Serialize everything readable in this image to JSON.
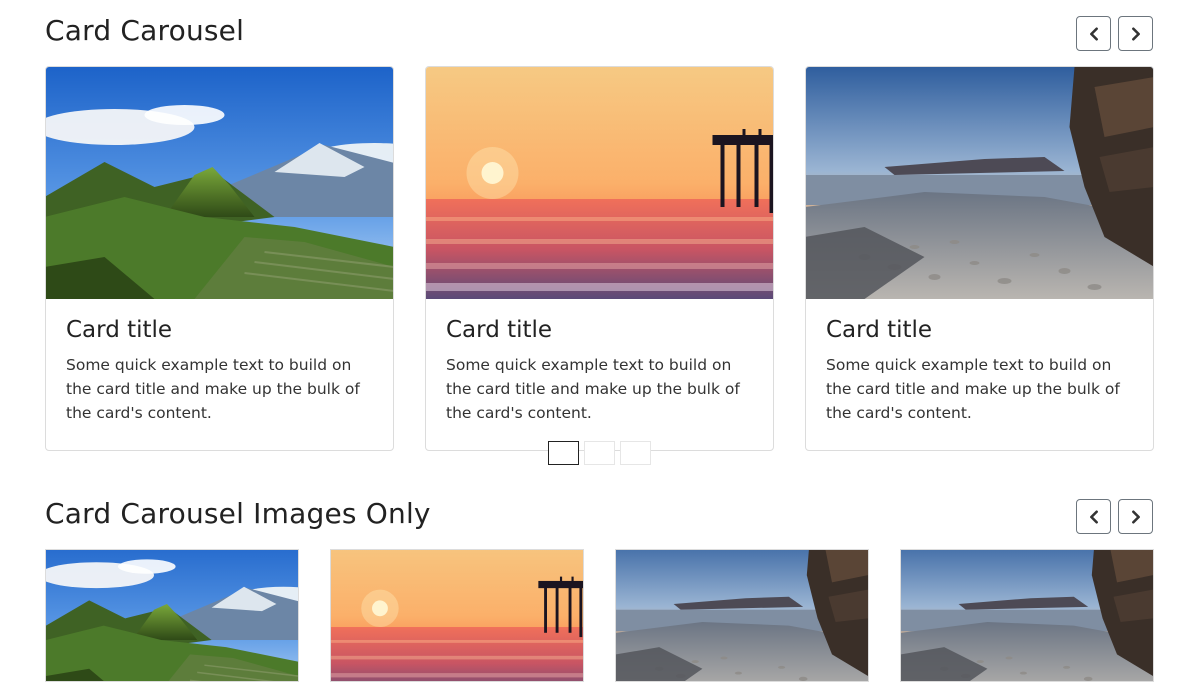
{
  "carousel1": {
    "title": "Card Carousel",
    "prev_icon": "chevron-left-icon",
    "next_icon": "chevron-right-icon",
    "cards": [
      {
        "image": "mountain-ruins-photo",
        "title": "Card title",
        "text": "Some quick example text to build on the card title and make up the bulk of the card's content."
      },
      {
        "image": "sunset-pier-photo",
        "title": "Card title",
        "text": "Some quick example text to build on the card title and make up the bulk of the card's content."
      },
      {
        "image": "rocky-beach-photo",
        "title": "Card title",
        "text": "Some quick example text to build on the card title and make up the bulk of the card's content."
      }
    ],
    "indicators": 3,
    "active_indicator": 0
  },
  "carousel2": {
    "title": "Card Carousel Images Only",
    "prev_icon": "chevron-left-icon",
    "next_icon": "chevron-right-icon",
    "images": [
      "mountain-ruins-photo",
      "sunset-pier-photo",
      "rocky-beach-photo",
      "rocky-beach-photo"
    ]
  },
  "colors": {
    "button_border": "#6c757d",
    "card_border": "#dcdcdc",
    "active_indicator": "#222222"
  }
}
